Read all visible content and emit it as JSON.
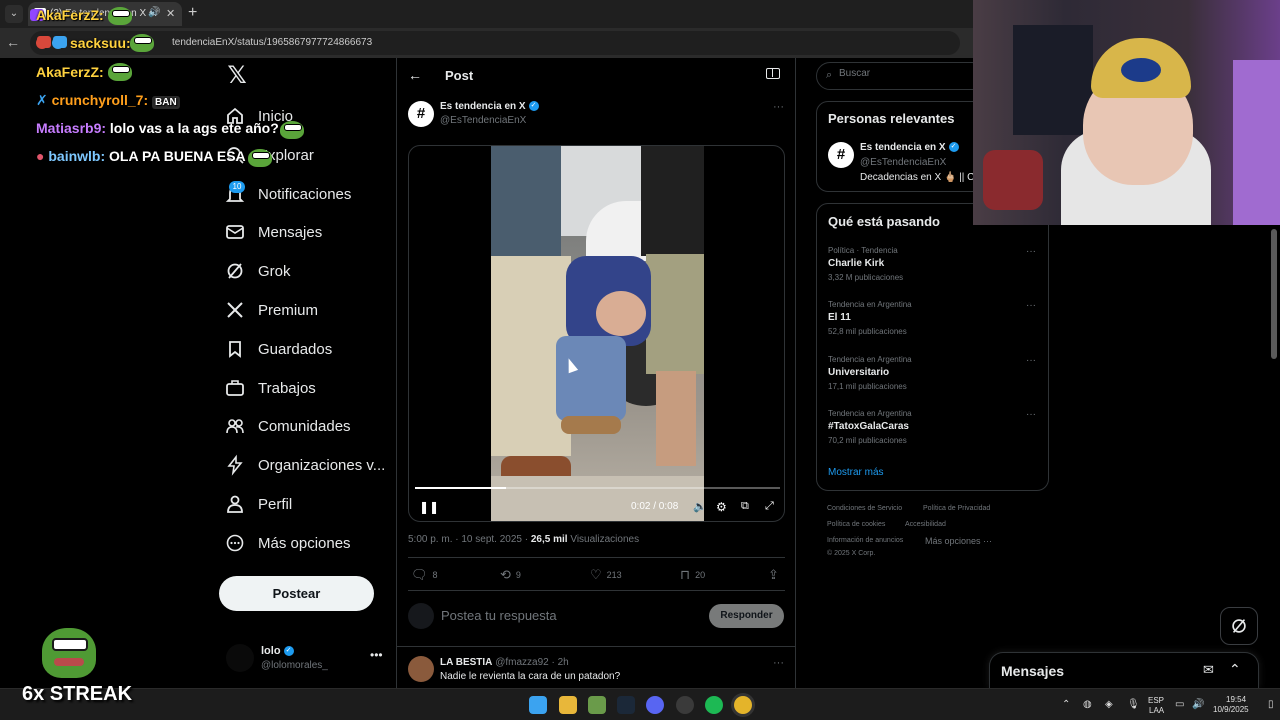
{
  "browser": {
    "tab_title": "(2) Es tendencia en X en X: ...",
    "url": "tendenciaEnX/status/1965867977724866673"
  },
  "chat": {
    "lines": [
      {
        "user": "AkaFerzZ:",
        "text": "",
        "color": "#ffd23f"
      },
      {
        "user": "sacksuu:",
        "text": "",
        "color": "#ffd23f"
      },
      {
        "user": "AkaFerzZ:",
        "text": "",
        "color": "#ffd23f"
      },
      {
        "user": "crunchyroll_7:",
        "text": "BAN",
        "color": "#ff9f1c"
      },
      {
        "user": "Matiasrb9:",
        "text": "lolo vas a la ags ete año?",
        "color": "#c77dff"
      },
      {
        "user": "bainwlb:",
        "text": "OLA PA BUENA ESA",
        "color": "#7ec8ff"
      }
    ],
    "streak": "6x STREAK"
  },
  "nav": {
    "items": [
      {
        "label": "Inicio",
        "icon": "home-icon"
      },
      {
        "label": "Explorar",
        "icon": "search-icon"
      },
      {
        "label": "Notificaciones",
        "icon": "bell-icon",
        "badge": "10"
      },
      {
        "label": "Mensajes",
        "icon": "envelope-icon"
      },
      {
        "label": "Grok",
        "icon": "grok-icon"
      },
      {
        "label": "Premium",
        "icon": "x-logo-icon"
      },
      {
        "label": "Guardados",
        "icon": "bookmark-icon"
      },
      {
        "label": "Trabajos",
        "icon": "briefcase-icon"
      },
      {
        "label": "Comunidades",
        "icon": "people-icon"
      },
      {
        "label": "Organizaciones v...",
        "icon": "lightning-icon"
      },
      {
        "label": "Perfil",
        "icon": "person-icon"
      },
      {
        "label": "Más opciones",
        "icon": "more-circle-icon"
      }
    ],
    "post_button": "Postear",
    "account": {
      "name": "lolo",
      "handle": "@lolomorales_"
    }
  },
  "post": {
    "header": "Post",
    "author_name": "Es tendencia en X",
    "author_handle": "@EsTendenciaEnX",
    "video": {
      "time": "0:02 / 0:08",
      "progress": 0.25
    },
    "time": "5:00 p. m. · 10 sept. 2025 · ",
    "views_count": "26,5 mil",
    "views_label": "Visualizaciones",
    "stats": {
      "replies": "8",
      "reposts": "9",
      "likes": "213",
      "bookmarks": "20"
    },
    "reply_placeholder": "Postea tu respuesta",
    "reply_button": "Responder",
    "first_reply": {
      "name": "LA BESTIA",
      "handle": "@fmazza92 · 2h",
      "text": "Nadie le revienta la cara de un patadon?"
    }
  },
  "sidebar": {
    "search_placeholder": "Buscar",
    "relevant": {
      "title": "Personas relevantes",
      "name": "Es tendencia en X",
      "handle": "@EsTendenciaEnX",
      "bio": "Decadencias en X 🖕🏼 || C"
    },
    "trends": {
      "title": "Qué está pasando",
      "items": [
        {
          "category": "Política · Tendencia",
          "name": "Charlie Kirk",
          "count": "3,32 M publicaciones"
        },
        {
          "category": "Tendencia en Argentina",
          "name": "El 11",
          "count": "52,8 mil publicaciones"
        },
        {
          "category": "Tendencia en Argentina",
          "name": "Universitario",
          "count": "17,1 mil publicaciones"
        },
        {
          "category": "Tendencia en Argentina",
          "name": "#TatoxGalaCaras",
          "count": "70,2 mil publicaciones"
        }
      ],
      "show_more": "Mostrar más"
    },
    "footer": {
      "tos": "Condiciones de Servicio",
      "privacy": "Política de Privacidad",
      "cookies": "Política de cookies",
      "accessibility": "Accesibilidad",
      "ads": "Información de anuncios",
      "more": "Más opciones ···",
      "copyright": "© 2025 X Corp."
    }
  },
  "messages_drawer": {
    "title": "Mensajes"
  },
  "taskbar": {
    "lang": "ESP",
    "layout": "LAA",
    "time": "19:54",
    "date": "10/9/2025"
  },
  "colors": {
    "accent": "#1d9bf0",
    "background": "#000000",
    "text": "#e7e9ea",
    "muted": "#71767b"
  }
}
